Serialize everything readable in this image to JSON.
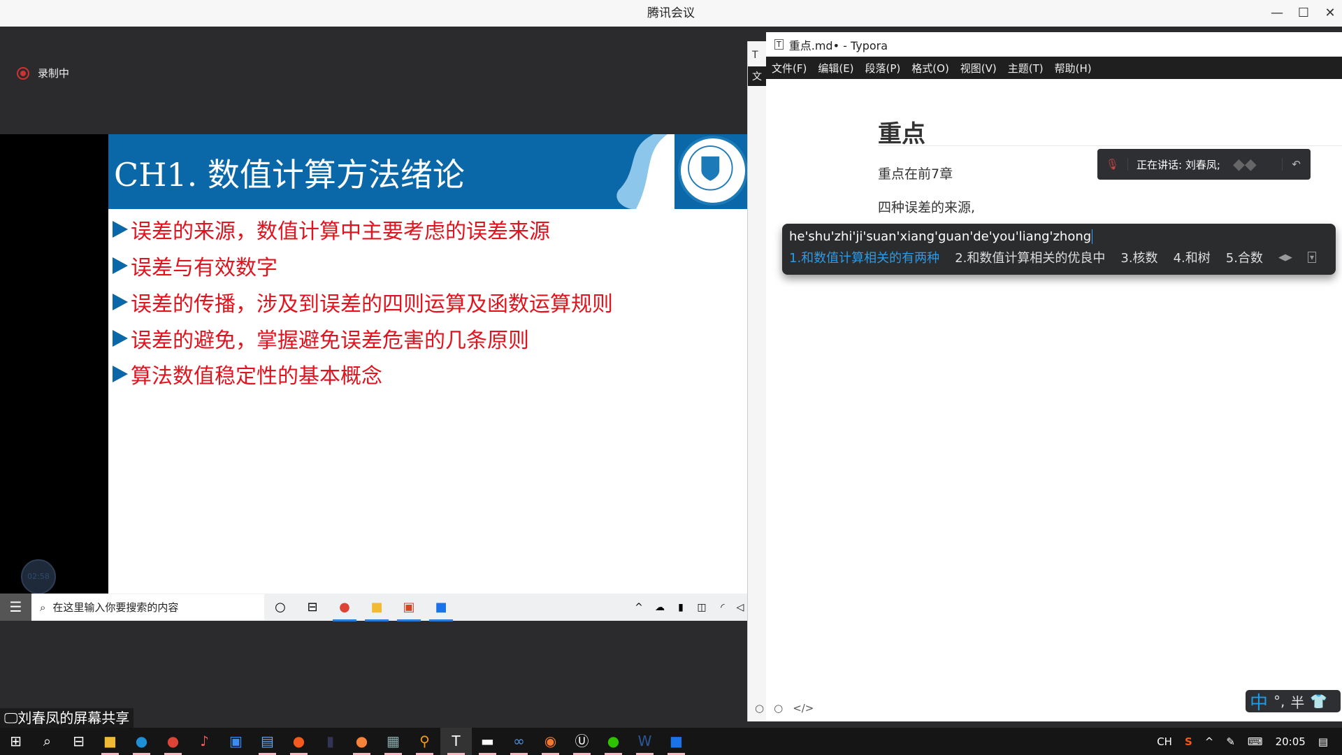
{
  "window": {
    "title": "腾讯会议",
    "controls": [
      "minimize",
      "maximize",
      "close"
    ]
  },
  "recording": {
    "label": "录制中"
  },
  "slide": {
    "title": "CH1. 数值计算方法绪论",
    "bullets": [
      "误差的来源，数值计算中主要考虑的误差来源",
      "误差与有效数字",
      "误差的传播，涉及到误差的四则运算及函数运算规则",
      "误差的避免，掌握避免误差危害的几条原则",
      "算法数值稳定性的基本概念"
    ],
    "accent": "#0a67a8",
    "text_color": "#e0141e"
  },
  "timer": "02:58",
  "remote_taskbar": {
    "search_placeholder": "在这里输入你要搜索的内容"
  },
  "share_label": "刘春凤的屏幕共享",
  "typora": {
    "title": "重点.md• - Typora",
    "menu": [
      "文件(F)",
      "编辑(E)",
      "段落(P)",
      "格式(O)",
      "视图(V)",
      "主题(T)",
      "帮助(H)"
    ],
    "behind_menu": "文",
    "heading": "重点",
    "paragraphs": [
      "重点在前7章",
      "四种误差的来源,"
    ]
  },
  "speaking": {
    "label": "正在讲话: 刘春凤;"
  },
  "ime": {
    "pinyin": "he'shu'zhi'ji'suan'xiang'guan'de'you'liang'zhong",
    "candidates": [
      "1.和数值计算相关的有两种",
      "2.和数值计算相关的优良中",
      "3.核数",
      "4.和树",
      "5.合数"
    ],
    "status": [
      "中",
      "°,",
      "半"
    ]
  },
  "tray": {
    "lang": "CH",
    "time": "20:05"
  }
}
